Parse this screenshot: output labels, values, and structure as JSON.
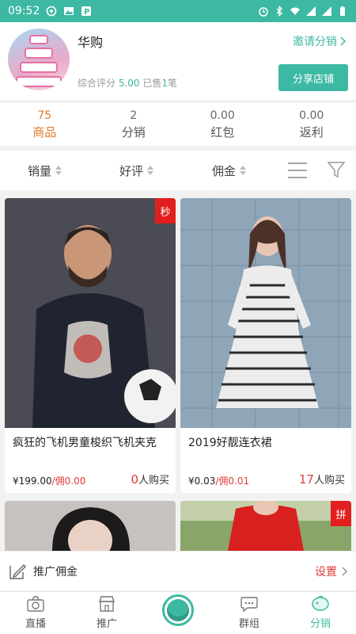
{
  "status_bar": {
    "time": "09:52"
  },
  "shop": {
    "name": "华购",
    "invite_label": "邀请分销",
    "rating_label": "综合评分",
    "rating_value": "5.00",
    "sold_prefix": "已售",
    "sold_count": "1",
    "sold_suffix": "笔",
    "share_label": "分享店铺"
  },
  "stats": [
    {
      "num": "75",
      "label": "商品",
      "active": true
    },
    {
      "num": "2",
      "label": "分销",
      "active": false
    },
    {
      "num": "0.00",
      "label": "红包",
      "active": false
    },
    {
      "num": "0.00",
      "label": "返利",
      "active": false
    }
  ],
  "filters": {
    "sales": "销量",
    "rating": "好评",
    "commission": "佣金"
  },
  "products": [
    {
      "title": "疯狂的飞机男童梭织飞机夹克",
      "price": "¥199.00",
      "commission": "/佣0.00",
      "buyers_num": "0",
      "buyers_suffix": "人购买",
      "tag": "秒",
      "colors": {
        "bg": "#4a4b54",
        "cloth": "#1f2430"
      }
    },
    {
      "title": "2019好靓连衣裙",
      "price": "¥0.03",
      "commission": "/佣0.01",
      "buyers_num": "17",
      "buyers_suffix": "人购买",
      "tag": "",
      "colors": {
        "bg": "#8fa6b8",
        "cloth": "#e9e9e9"
      }
    },
    {
      "tag": "",
      "colors": {
        "bg": "#c7c2c0"
      }
    },
    {
      "tag": "拼",
      "colors": {
        "bg": "#8aa56a",
        "cloth": "#d8201f"
      }
    }
  ],
  "promo": {
    "label": "推广佣金",
    "action": "设置"
  },
  "tabbar": [
    {
      "label": "直播"
    },
    {
      "label": "推广"
    },
    {
      "label": ""
    },
    {
      "label": "群组"
    },
    {
      "label": "分销",
      "active": true
    }
  ],
  "colors": {
    "accent": "#3db9a3",
    "highlight": "#e0782b",
    "price_red": "#e23b3b",
    "tag_red": "#e21f1f"
  }
}
